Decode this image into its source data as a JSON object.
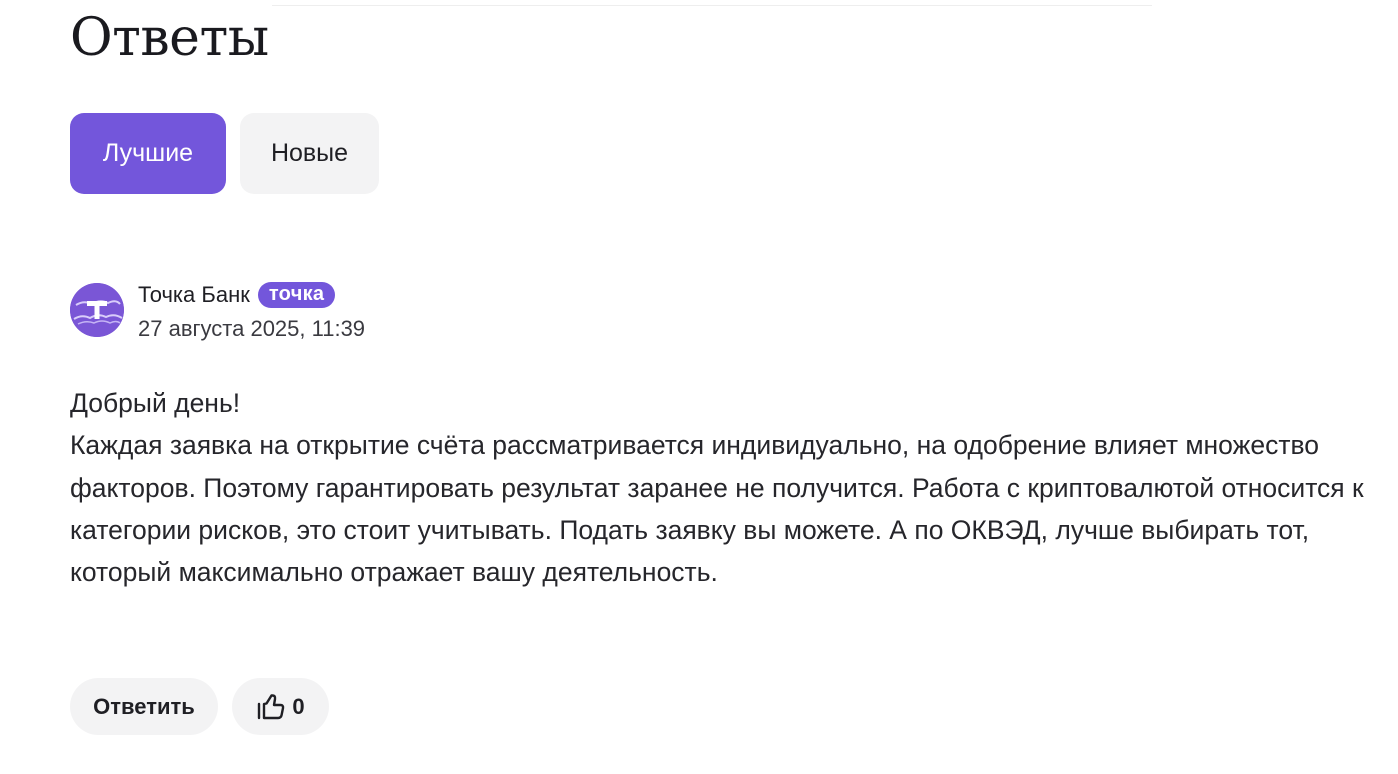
{
  "page": {
    "title": "Ответы"
  },
  "tabs": [
    {
      "label": "Лучшие",
      "active": true
    },
    {
      "label": "Новые",
      "active": false
    }
  ],
  "answer": {
    "author": "Точка Банк",
    "badge": "точка",
    "avatar_icon": "tochka-logo-icon",
    "date": "27 августа 2025, 11:39",
    "greeting": "Добрый день!",
    "text": "Каждая заявка на открытие счёта рассматривается индивидуально, на одобрение влияет множество факторов. Поэтому гарантировать результат заранее не получится. Работа с криптовалютой относится к категории рисков, это стоит учитывать. Подать заявку вы можете. А по ОКВЭД, лучше выбирать тот, который максимально отражает вашу деятельность."
  },
  "actions": {
    "reply_label": "Ответить",
    "like_icon": "thumbs-up-icon",
    "like_count": "0"
  },
  "colors": {
    "accent": "#7356db",
    "tab_inactive_bg": "#f3f3f4",
    "text": "#1f1f24"
  }
}
